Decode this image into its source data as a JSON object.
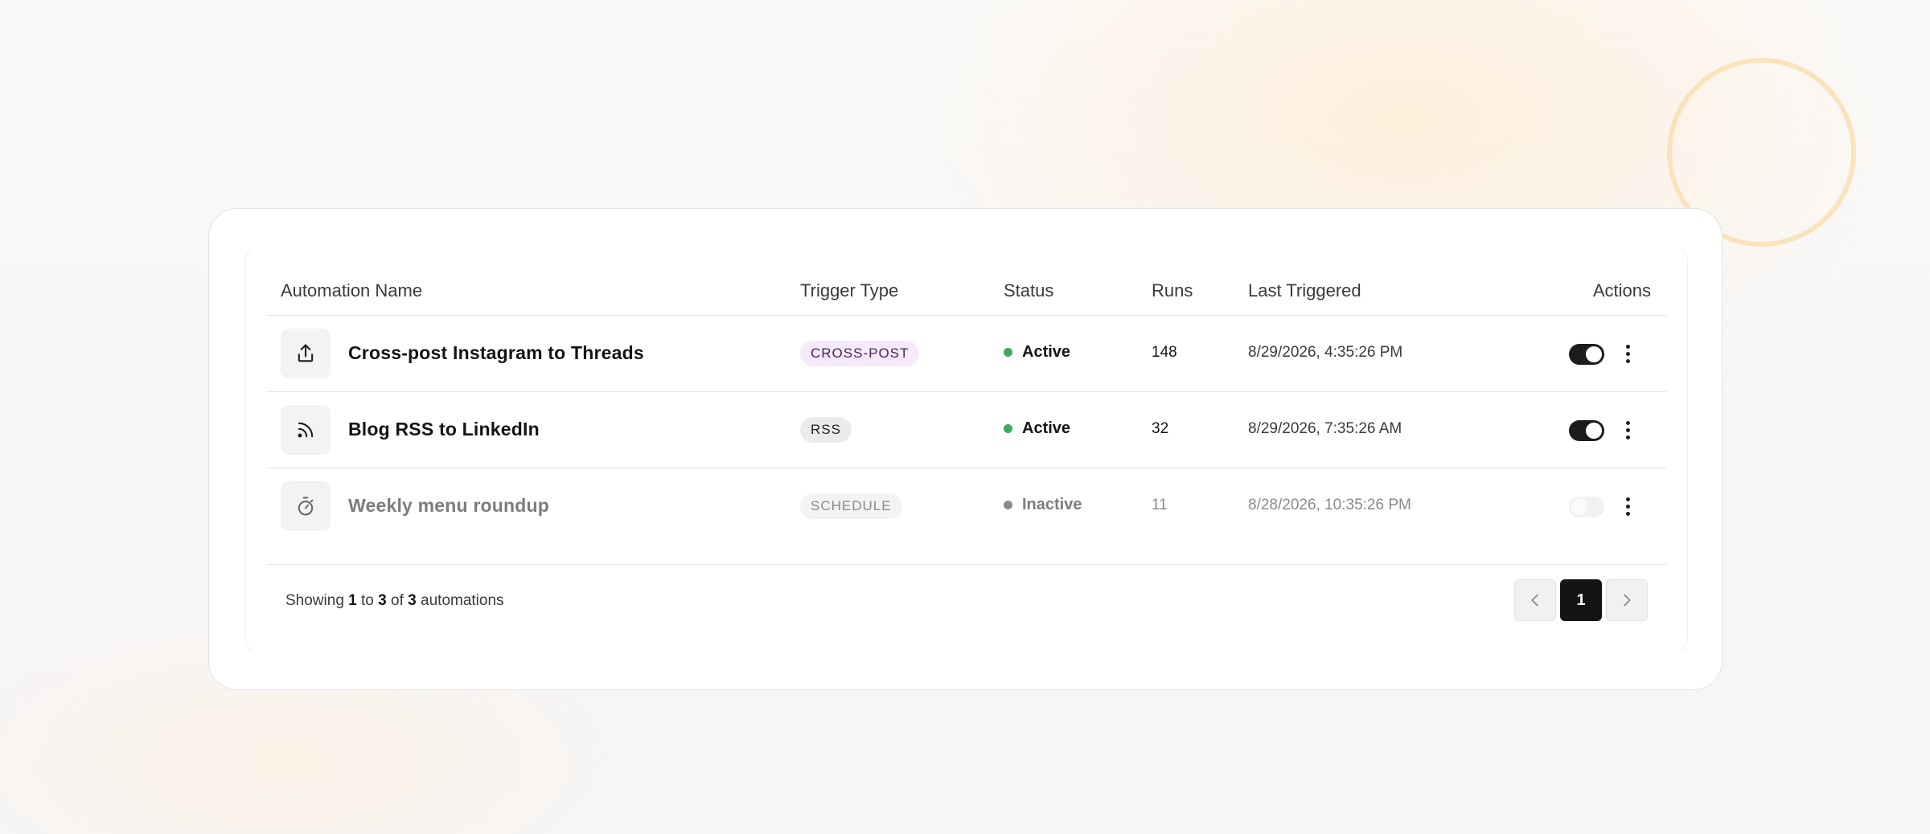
{
  "table": {
    "headers": {
      "name": "Automation Name",
      "trigger": "Trigger Type",
      "status": "Status",
      "runs": "Runs",
      "last": "Last Triggered",
      "actions": "Actions"
    },
    "rows": [
      {
        "icon": "share-upload-icon",
        "name": "Cross-post Instagram to Threads",
        "trigger": "CROSS-POST",
        "status": "Active",
        "status_color": "#3daa5b",
        "runs": "148",
        "last_triggered": "8/29/2026, 4:35:26 PM",
        "enabled": true
      },
      {
        "icon": "rss-icon",
        "name": "Blog RSS to LinkedIn",
        "trigger": "RSS",
        "status": "Active",
        "status_color": "#3daa5b",
        "runs": "32",
        "last_triggered": "8/29/2026, 7:35:26 AM",
        "enabled": true
      },
      {
        "icon": "stopwatch-icon",
        "name": "Weekly menu roundup",
        "trigger": "SCHEDULE",
        "status": "Inactive",
        "status_color": "#8a8a8a",
        "runs": "11",
        "last_triggered": "8/28/2026, 10:35:26 PM",
        "enabled": false
      }
    ]
  },
  "footer": {
    "showing_prefix": "Showing",
    "from": "1",
    "to_word": "to",
    "to": "3",
    "of_word": "of",
    "total": "3",
    "suffix": "automations"
  },
  "pagination": {
    "current_page": "1",
    "prev_icon": "chevron-left-icon",
    "next_icon": "chevron-right-icon"
  },
  "colors": {
    "accent": "#141414",
    "active": "#3daa5b",
    "inactive": "#8a8a8a"
  }
}
